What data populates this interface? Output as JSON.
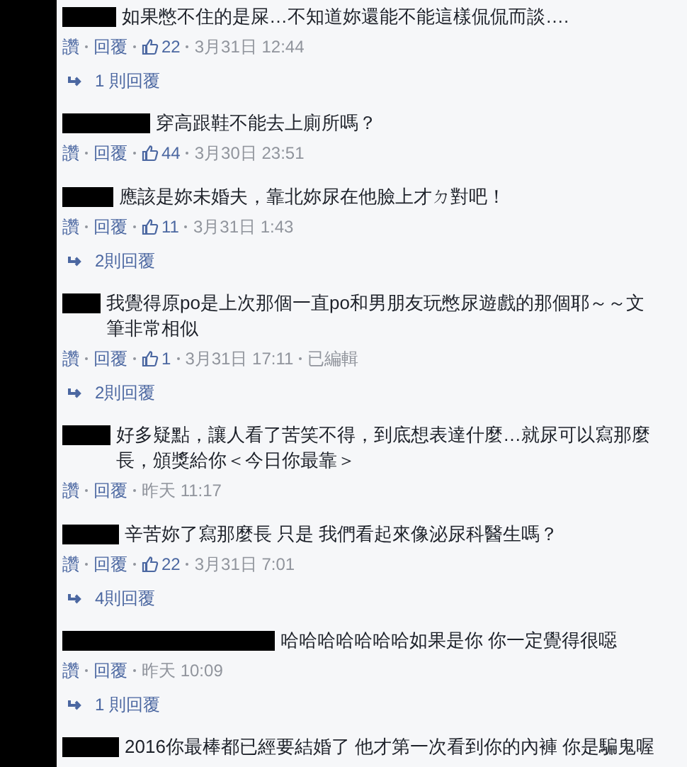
{
  "comments": [
    {
      "text": "如果憋不住的是屎…不知道妳還能不能這樣侃侃而談….",
      "like": "讚",
      "reply": "回覆",
      "likes": "22",
      "time": "3月31日 12:44",
      "replies": "1 則回覆"
    },
    {
      "text": "穿高跟鞋不能去上廁所嗎？",
      "like": "讚",
      "reply": "回覆",
      "likes": "44",
      "time": "3月30日 23:51"
    },
    {
      "text": "應該是妳未婚夫，靠北妳尿在他臉上才ㄉ對吧！",
      "like": "讚",
      "reply": "回覆",
      "likes": "11",
      "time": "3月31日 1:43",
      "replies": "2則回覆"
    },
    {
      "text": "我覺得原po是上次那個一直po和男朋友玩憋尿遊戲的那個耶～～文筆非常相似",
      "like": "讚",
      "reply": "回覆",
      "likes": "1",
      "time": "3月31日 17:11",
      "edited": "已編輯",
      "replies": "2則回覆"
    },
    {
      "text": "好多疑點，讓人看了苦笑不得，到底想表達什麼…就尿可以寫那麼長，頒獎給你＜今日你最靠＞",
      "like": "讚",
      "reply": "回覆",
      "time": "昨天 11:17"
    },
    {
      "text": "辛苦妳了寫那麼長 只是 我們看起來像泌尿科醫生嗎？",
      "like": "讚",
      "reply": "回覆",
      "likes": "22",
      "time": "3月31日 7:01",
      "replies": "4則回覆"
    },
    {
      "text": "哈哈哈哈哈哈哈如果是你 你一定覺得很噁",
      "like": "讚",
      "reply": "回覆",
      "time": "昨天 10:09",
      "replies": "1 則回覆"
    },
    {
      "text": "2016你最棒都已經要結婚了 他才第一次看到你的內褲 你是騙鬼喔"
    }
  ]
}
